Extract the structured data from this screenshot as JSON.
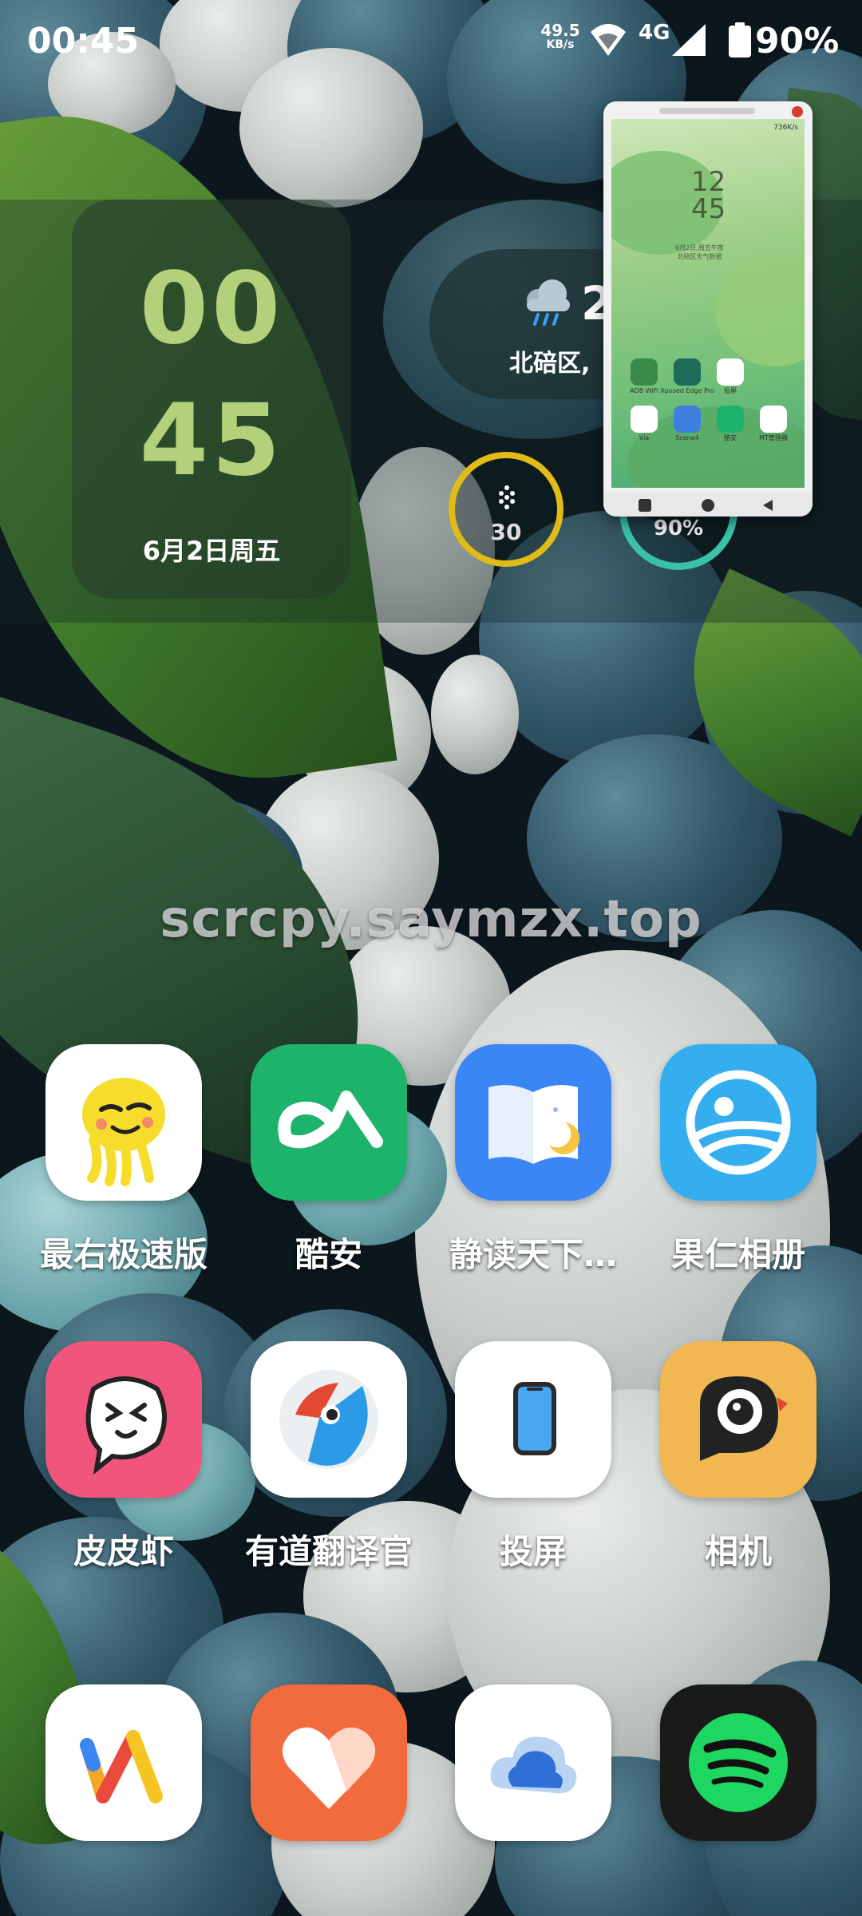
{
  "status_bar": {
    "time": "00:45",
    "net_rate_value": "49.5",
    "net_rate_unit": "KB/s",
    "network_type": "4G",
    "battery_percent": "90%"
  },
  "clock_widget": {
    "hour": "00",
    "minute": "45",
    "date": "6月2日周五"
  },
  "weather_widget": {
    "temperature": "2",
    "location": "北碚区,"
  },
  "ring_widgets": {
    "steps_value": "30",
    "battery_value": "90%"
  },
  "mirror_window": {
    "status_text": "736K/s",
    "clock_hour": "12",
    "clock_minute": "45",
    "date_line1": "6月2日,周五午夜",
    "date_line2": "北碚区天气数据",
    "apps": [
      {
        "label": "ADB WiFi",
        "color": "#3a8a4a"
      },
      {
        "label": "Xposed Edge Pro",
        "color": "#1f6b5a"
      },
      {
        "label": "投屏",
        "color": "#ffffff"
      },
      {
        "label": "",
        "color": "transparent"
      },
      {
        "label": "Via",
        "color": "#ffffff"
      },
      {
        "label": "Scene4",
        "color": "#3f7fe0"
      },
      {
        "label": "酷安",
        "color": "#1db36b"
      },
      {
        "label": "MT管理器",
        "color": "#ffffff"
      }
    ]
  },
  "watermark": "scrcpy.saymzx.top",
  "apps": [
    {
      "label": "最右极速版",
      "icon": "zuiyou-icon",
      "bg": "#ffffff"
    },
    {
      "label": "酷安",
      "icon": "coolapk-icon",
      "bg": "#1db36b"
    },
    {
      "label": "静读天下…",
      "icon": "moon-reader-icon",
      "bg": "#3b86f5"
    },
    {
      "label": "果仁相册",
      "icon": "gallery-icon",
      "bg": "#35aef0"
    },
    {
      "label": "皮皮虾",
      "icon": "pipixia-icon",
      "bg": "#f0557c"
    },
    {
      "label": "有道翻译官",
      "icon": "youdao-icon",
      "bg": "#ffffff"
    },
    {
      "label": "投屏",
      "icon": "screen-cast-icon",
      "bg": "#ffffff"
    },
    {
      "label": "相机",
      "icon": "camera-icon",
      "bg": "#f1b851"
    },
    {
      "label": "",
      "icon": "via-browser-icon",
      "bg": "#ffffff"
    },
    {
      "label": "",
      "icon": "health-heart-icon",
      "bg": "#f26b3d"
    },
    {
      "label": "",
      "icon": "cloud-icon",
      "bg": "#ffffff"
    },
    {
      "label": "",
      "icon": "spotify-icon",
      "bg": "#1a1a1a"
    }
  ]
}
